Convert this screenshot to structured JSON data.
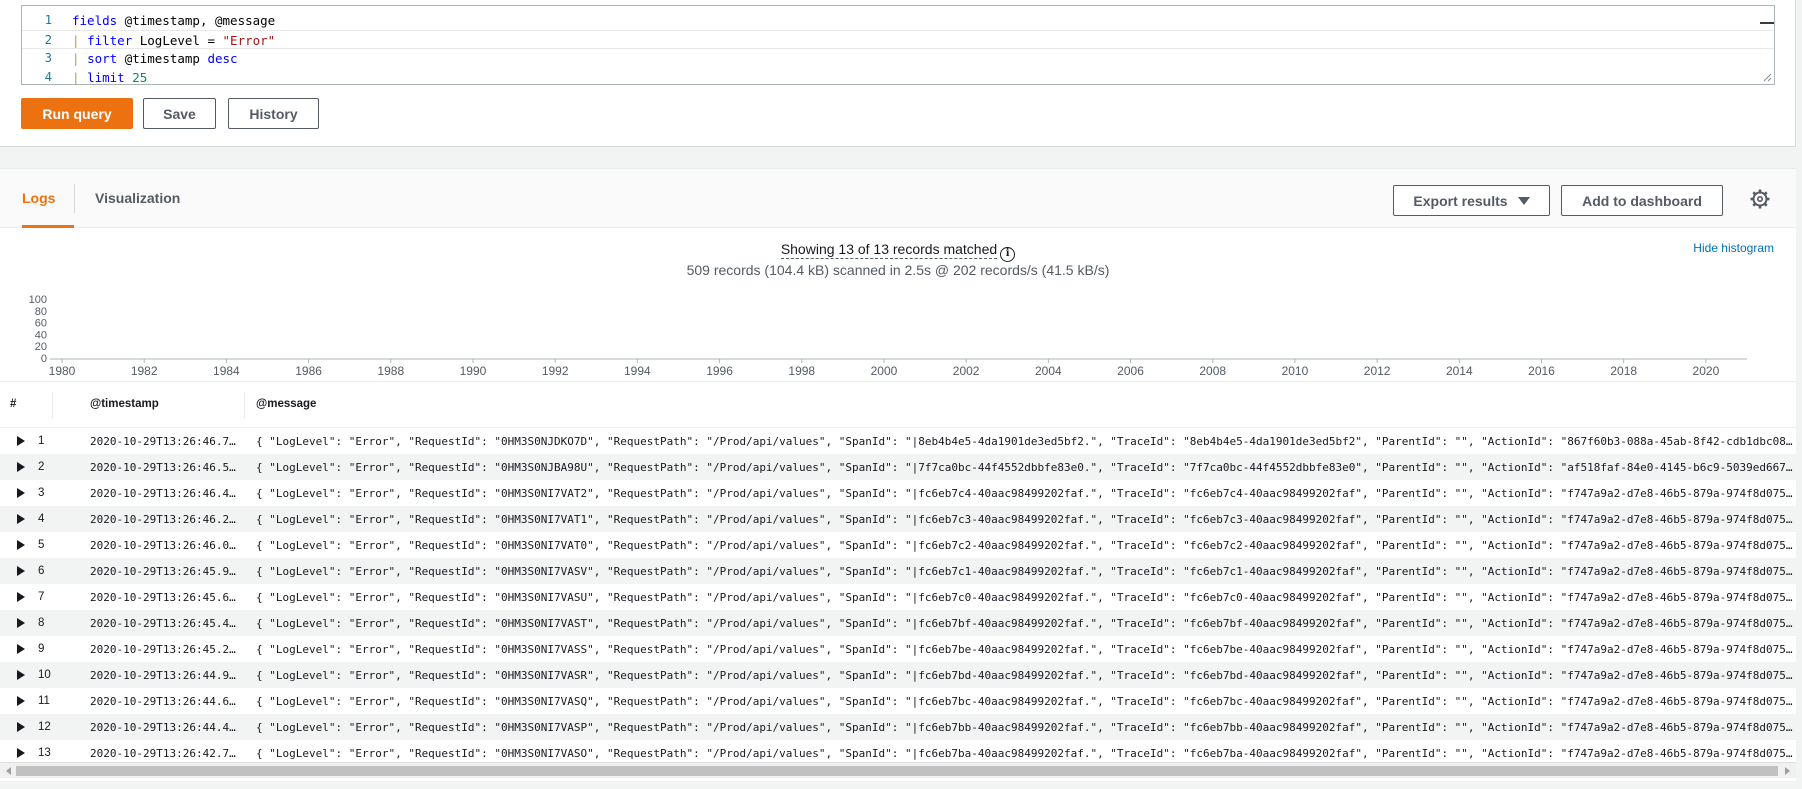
{
  "query": {
    "lines": [
      {
        "num": "1",
        "tokens": [
          {
            "t": "fields",
            "c": "kw"
          },
          {
            "t": " @timestamp, @message",
            "c": "plain"
          }
        ]
      },
      {
        "num": "2",
        "tokens": [
          {
            "t": "| ",
            "c": "pipe"
          },
          {
            "t": "filter",
            "c": "kw"
          },
          {
            "t": " LogLevel = ",
            "c": "plain"
          },
          {
            "t": "\"Error\"",
            "c": "str"
          }
        ]
      },
      {
        "num": "3",
        "tokens": [
          {
            "t": "| ",
            "c": "pipe"
          },
          {
            "t": "sort",
            "c": "kw"
          },
          {
            "t": " @timestamp ",
            "c": "plain"
          },
          {
            "t": "desc",
            "c": "kw"
          }
        ]
      },
      {
        "num": "4",
        "tokens": [
          {
            "t": "| ",
            "c": "pipe"
          },
          {
            "t": "limit",
            "c": "kw"
          },
          {
            "t": " ",
            "c": "plain"
          },
          {
            "t": "25",
            "c": "num"
          }
        ]
      }
    ],
    "run_label": "Run query",
    "save_label": "Save",
    "history_label": "History"
  },
  "results": {
    "tabs": [
      {
        "label": "Logs",
        "active": true
      },
      {
        "label": "Visualization",
        "active": false
      }
    ],
    "export_label": "Export results",
    "dashboard_label": "Add to dashboard",
    "showing_text": "Showing 13 of 13 records matched",
    "scanned_text": "509 records (104.4 kB) scanned in 2.5s @ 202 records/s (41.5 kB/s)",
    "hide_histogram_label": "Hide histogram",
    "columns": {
      "index": "#",
      "timestamp": "@timestamp",
      "message": "@message"
    },
    "rows": [
      {
        "index": "1",
        "timestamp": "2020-10-29T13:26:46.74…",
        "message": "{ \"LogLevel\": \"Error\", \"RequestId\": \"0HM3S0NJDKO7D\", \"RequestPath\": \"/Prod/api/values\", \"SpanId\": \"|8eb4b4e5-4da1901de3ed5bf2.\", \"TraceId\": \"8eb4b4e5-4da1901de3ed5bf2\", \"ParentId\": \"\", \"ActionId\": \"867f60b3-088a-45ab-8f42-cdb1dbc08f…"
      },
      {
        "index": "2",
        "timestamp": "2020-10-29T13:26:46.54…",
        "message": "{ \"LogLevel\": \"Error\", \"RequestId\": \"0HM3S0NJBA98U\", \"RequestPath\": \"/Prod/api/values\", \"SpanId\": \"|7f7ca0bc-44f4552dbbfe83e0.\", \"TraceId\": \"7f7ca0bc-44f4552dbbfe83e0\", \"ParentId\": \"\", \"ActionId\": \"af518faf-84e0-4145-b6c9-5039ed6677…"
      },
      {
        "index": "3",
        "timestamp": "2020-10-29T13:26:46.43…",
        "message": "{ \"LogLevel\": \"Error\", \"RequestId\": \"0HM3S0NI7VAT2\", \"RequestPath\": \"/Prod/api/values\", \"SpanId\": \"|fc6eb7c4-40aac98499202faf.\", \"TraceId\": \"fc6eb7c4-40aac98499202faf\", \"ParentId\": \"\", \"ActionId\": \"f747a9a2-d7e8-46b5-879a-974f8d0751…"
      },
      {
        "index": "4",
        "timestamp": "2020-10-29T13:26:46.21…",
        "message": "{ \"LogLevel\": \"Error\", \"RequestId\": \"0HM3S0NI7VAT1\", \"RequestPath\": \"/Prod/api/values\", \"SpanId\": \"|fc6eb7c3-40aac98499202faf.\", \"TraceId\": \"fc6eb7c3-40aac98499202faf\", \"ParentId\": \"\", \"ActionId\": \"f747a9a2-d7e8-46b5-879a-974f8d0751…"
      },
      {
        "index": "5",
        "timestamp": "2020-10-29T13:26:46.03…",
        "message": "{ \"LogLevel\": \"Error\", \"RequestId\": \"0HM3S0NI7VAT0\", \"RequestPath\": \"/Prod/api/values\", \"SpanId\": \"|fc6eb7c2-40aac98499202faf.\", \"TraceId\": \"fc6eb7c2-40aac98499202faf\", \"ParentId\": \"\", \"ActionId\": \"f747a9a2-d7e8-46b5-879a-974f8d0751…"
      },
      {
        "index": "6",
        "timestamp": "2020-10-29T13:26:45.91…",
        "message": "{ \"LogLevel\": \"Error\", \"RequestId\": \"0HM3S0NI7VASV\", \"RequestPath\": \"/Prod/api/values\", \"SpanId\": \"|fc6eb7c1-40aac98499202faf.\", \"TraceId\": \"fc6eb7c1-40aac98499202faf\", \"ParentId\": \"\", \"ActionId\": \"f747a9a2-d7e8-46b5-879a-974f8d0751…"
      },
      {
        "index": "7",
        "timestamp": "2020-10-29T13:26:45.69…",
        "message": "{ \"LogLevel\": \"Error\", \"RequestId\": \"0HM3S0NI7VASU\", \"RequestPath\": \"/Prod/api/values\", \"SpanId\": \"|fc6eb7c0-40aac98499202faf.\", \"TraceId\": \"fc6eb7c0-40aac98499202faf\", \"ParentId\": \"\", \"ActionId\": \"f747a9a2-d7e8-46b5-879a-974f8d0751…"
      },
      {
        "index": "8",
        "timestamp": "2020-10-29T13:26:45.43…",
        "message": "{ \"LogLevel\": \"Error\", \"RequestId\": \"0HM3S0NI7VAST\", \"RequestPath\": \"/Prod/api/values\", \"SpanId\": \"|fc6eb7bf-40aac98499202faf.\", \"TraceId\": \"fc6eb7bf-40aac98499202faf\", \"ParentId\": \"\", \"ActionId\": \"f747a9a2-d7e8-46b5-879a-974f8d0751…"
      },
      {
        "index": "9",
        "timestamp": "2020-10-29T13:26:45.25…",
        "message": "{ \"LogLevel\": \"Error\", \"RequestId\": \"0HM3S0NI7VASS\", \"RequestPath\": \"/Prod/api/values\", \"SpanId\": \"|fc6eb7be-40aac98499202faf.\", \"TraceId\": \"fc6eb7be-40aac98499202faf\", \"ParentId\": \"\", \"ActionId\": \"f747a9a2-d7e8-46b5-879a-974f8d0751…"
      },
      {
        "index": "10",
        "timestamp": "2020-10-29T13:26:44.97…",
        "message": "{ \"LogLevel\": \"Error\", \"RequestId\": \"0HM3S0NI7VASR\", \"RequestPath\": \"/Prod/api/values\", \"SpanId\": \"|fc6eb7bd-40aac98499202faf.\", \"TraceId\": \"fc6eb7bd-40aac98499202faf\", \"ParentId\": \"\", \"ActionId\": \"f747a9a2-d7e8-46b5-879a-974f8d0751…"
      },
      {
        "index": "11",
        "timestamp": "2020-10-29T13:26:44.67…",
        "message": "{ \"LogLevel\": \"Error\", \"RequestId\": \"0HM3S0NI7VASQ\", \"RequestPath\": \"/Prod/api/values\", \"SpanId\": \"|fc6eb7bc-40aac98499202faf.\", \"TraceId\": \"fc6eb7bc-40aac98499202faf\", \"ParentId\": \"\", \"ActionId\": \"f747a9a2-d7e8-46b5-879a-974f8d0751…"
      },
      {
        "index": "12",
        "timestamp": "2020-10-29T13:26:44.49…",
        "message": "{ \"LogLevel\": \"Error\", \"RequestId\": \"0HM3S0NI7VASP\", \"RequestPath\": \"/Prod/api/values\", \"SpanId\": \"|fc6eb7bb-40aac98499202faf.\", \"TraceId\": \"fc6eb7bb-40aac98499202faf\", \"ParentId\": \"\", \"ActionId\": \"f747a9a2-d7e8-46b5-879a-974f8d0751…"
      },
      {
        "index": "13",
        "timestamp": "2020-10-29T13:26:42.79…",
        "message": "{ \"LogLevel\": \"Error\", \"RequestId\": \"0HM3S0NI7VASO\", \"RequestPath\": \"/Prod/api/values\", \"SpanId\": \"|fc6eb7ba-40aac98499202faf.\", \"TraceId\": \"fc6eb7ba-40aac98499202faf\", \"ParentId\": \"\", \"ActionId\": \"f747a9a2-d7e8-46b5-879a-974f8d0751…"
      }
    ]
  },
  "chart_data": {
    "type": "bar",
    "title": "",
    "xlabel": "",
    "ylabel": "",
    "x_ticks": [
      "1980",
      "1982",
      "1984",
      "1986",
      "1988",
      "1990",
      "1992",
      "1994",
      "1996",
      "1998",
      "2000",
      "2002",
      "2004",
      "2006",
      "2008",
      "2010",
      "2012",
      "2014",
      "2016",
      "2018",
      "2020"
    ],
    "y_ticks": [
      "0",
      "20",
      "40",
      "60",
      "80",
      "100"
    ],
    "xlim": [
      1980,
      2021
    ],
    "ylim": [
      0,
      100
    ],
    "series": [],
    "grid": false
  },
  "colors": {
    "accent": "#ec7211",
    "link": "#0073bb",
    "keyword": "#0000ff",
    "string": "#a31515",
    "number": "#098658"
  },
  "icons": [
    "info-icon",
    "caret-down-icon",
    "gear-icon",
    "expand-row-icon"
  ]
}
